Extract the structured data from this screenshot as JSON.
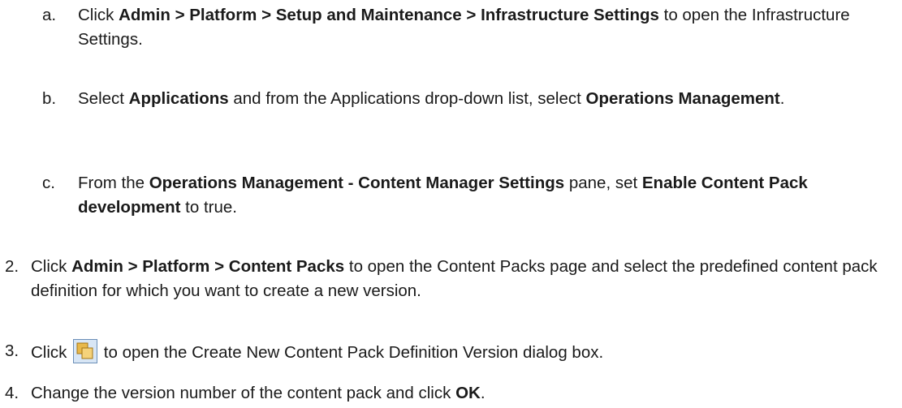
{
  "steps": {
    "a": {
      "marker": "a.",
      "pre": "Click ",
      "bold1": "Admin > Platform > Setup and Maintenance > Infrastructure Settings",
      "post": " to open the Infrastructure Settings."
    },
    "b": {
      "marker": "b.",
      "pre": "Select ",
      "bold1": "Applications",
      "mid": " and from the Applications drop-down list, select ",
      "bold2": "Operations Management",
      "post": "."
    },
    "c": {
      "marker": "c.",
      "pre": "From the ",
      "bold1": "Operations Management - Content Manager Settings",
      "mid": " pane, set ",
      "bold2": "Enable Content Pack development",
      "post": " to true."
    },
    "s2": {
      "marker": "2.",
      "pre": "Click ",
      "bold1": "Admin > Platform > Content Packs",
      "post": " to open the Content Packs page and select the predefined content pack definition for which you want to create a new version."
    },
    "s3": {
      "marker": "3.",
      "pre": "Click ",
      "icon": "create-new-version-icon",
      "post": " to open the Create New Content Pack Definition Version dialog box."
    },
    "s4": {
      "marker": "4.",
      "pre": "Change the version number of the content pack and click ",
      "bold1": "OK",
      "post": "."
    }
  },
  "colors": {
    "text": "#1a1a1a",
    "icon_border": "#6b8fb8",
    "icon_fill": "#e8b84a",
    "icon_bg": "#d8e6f5"
  }
}
